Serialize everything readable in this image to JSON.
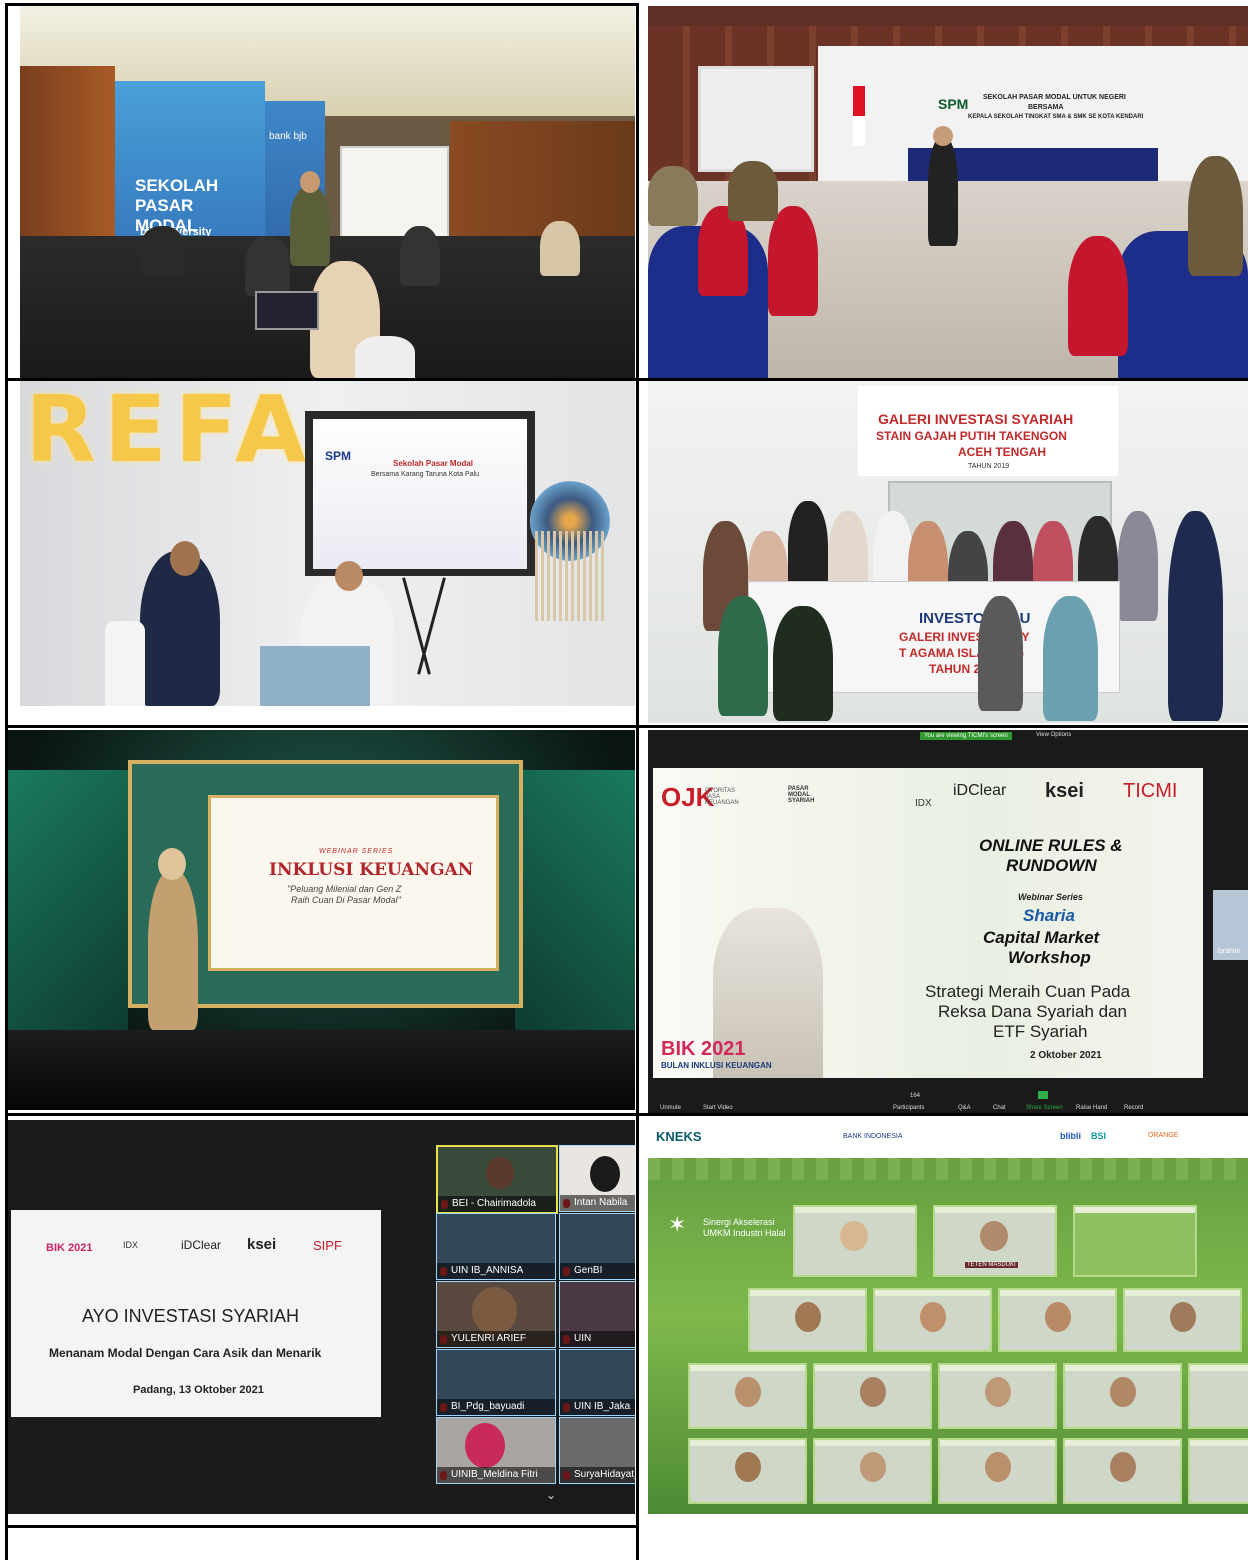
{
  "panels": {
    "p1": {
      "banner_title": "SEKOLAH PASAR MODAL",
      "brand": "bank bjb",
      "sub_brand": "bjb university"
    },
    "p2": {
      "line1": "SEKOLAH PASAR MODAL UNTUK NEGERI",
      "line2": "BERSAMA",
      "line3": "KEPALA SEKOLAH TINGKAT SMA & SMK SE KOTA KENDARI",
      "logo": "SPM"
    },
    "p3": {
      "sign": "REFA",
      "screen_title": "Sekolah Pasar Modal",
      "screen_sub": "Bersama Karang Taruna Kota Palu",
      "logo": "SPM"
    },
    "p4": {
      "banner1": "GALERI INVESTASI SYARIAH",
      "banner2": "STAIN GAJAH PUTIH TAKENGON",
      "banner3": "ACEH TENGAH",
      "year": "TAHUN 2019",
      "club": "INVESTOR CLU",
      "galeri": "GALERI INVESTASI SY",
      "agama": "T AGAMA ISLAM NEG",
      "tahun": "TAHUN 2021"
    },
    "p5": {
      "series": "WEBINAR SERIES",
      "title": "INKLUSI KEUANGAN",
      "subtitle_1": "\"Peluang Milenial dan Gen Z",
      "subtitle_2": "Raih Cuan Di Pasar Modal\""
    },
    "p6": {
      "banner": "You are viewing TICMI's screen",
      "view_options": "View Options",
      "ojk": "OJK",
      "ojk_text": "OTORITAS JASA KEUANGAN",
      "pasar": "PASAR MODAL SYARIAH",
      "idx": "IDX",
      "idclear": "iDClear",
      "ksei": "ksei",
      "ticmi": "TICMI",
      "rules_1": "ONLINE RULES &",
      "rules_2": "RUNDOWN",
      "webinar": "Webinar Series",
      "sharia": "Sharia",
      "capital": "Capital Market",
      "workshop": "Workshop",
      "strat_1": "Strategi Meraih Cuan Pada",
      "strat_2": "Reksa Dana Syariah dan",
      "strat_3": "ETF Syariah",
      "date": "2 Oktober 2021",
      "bik": "BIK 2021",
      "bik_sub": "BULAN INKLUSI KEUANGAN",
      "side_name": "Ibrahim",
      "toolbar": [
        "Unmute",
        "Start Video",
        "Participants",
        "Q&A",
        "Chat",
        "Share Screen",
        "Raise Hand",
        "Record"
      ],
      "participants_count": "164"
    },
    "p7": {
      "bik": "BIK 2021",
      "bik_sub": "BULAN INKLUSI KEUANGAN",
      "idx": "IDX",
      "idclear": "iDClear",
      "ksei": "ksei",
      "sipf": "SIPF",
      "title": "AYO INVESTASI SYARIAH",
      "subtitle": "Menanam Modal Dengan Cara Asik dan Menarik",
      "date": "Padang, 13 Oktober 2021",
      "participants": [
        "BEI - Chairimadola",
        "Intan Nabila Kha",
        "UIN IB_ANNISA FEBRI...",
        "GenBI UINIB_Syahru",
        "YULENRI ARIEF HIDAY...",
        "UIN IB_DESTHIA IRS",
        "BI_Pdg_bayuadi Hardi...",
        "UIN IB_Jaka Fajar W",
        "UINIB_Meldina Fitri R...",
        "SuryaHidayat_UNH"
      ]
    },
    "p8": {
      "kneks": "KNEKS",
      "bank": "BANK INDONESIA",
      "orange": "ORANGE",
      "blibli": "blibli",
      "bsi": "BSI",
      "title_1": "Sinergi Akselerasi",
      "title_2": "UMKM Industri Halal",
      "host": "TETEN MASDUKI"
    }
  }
}
